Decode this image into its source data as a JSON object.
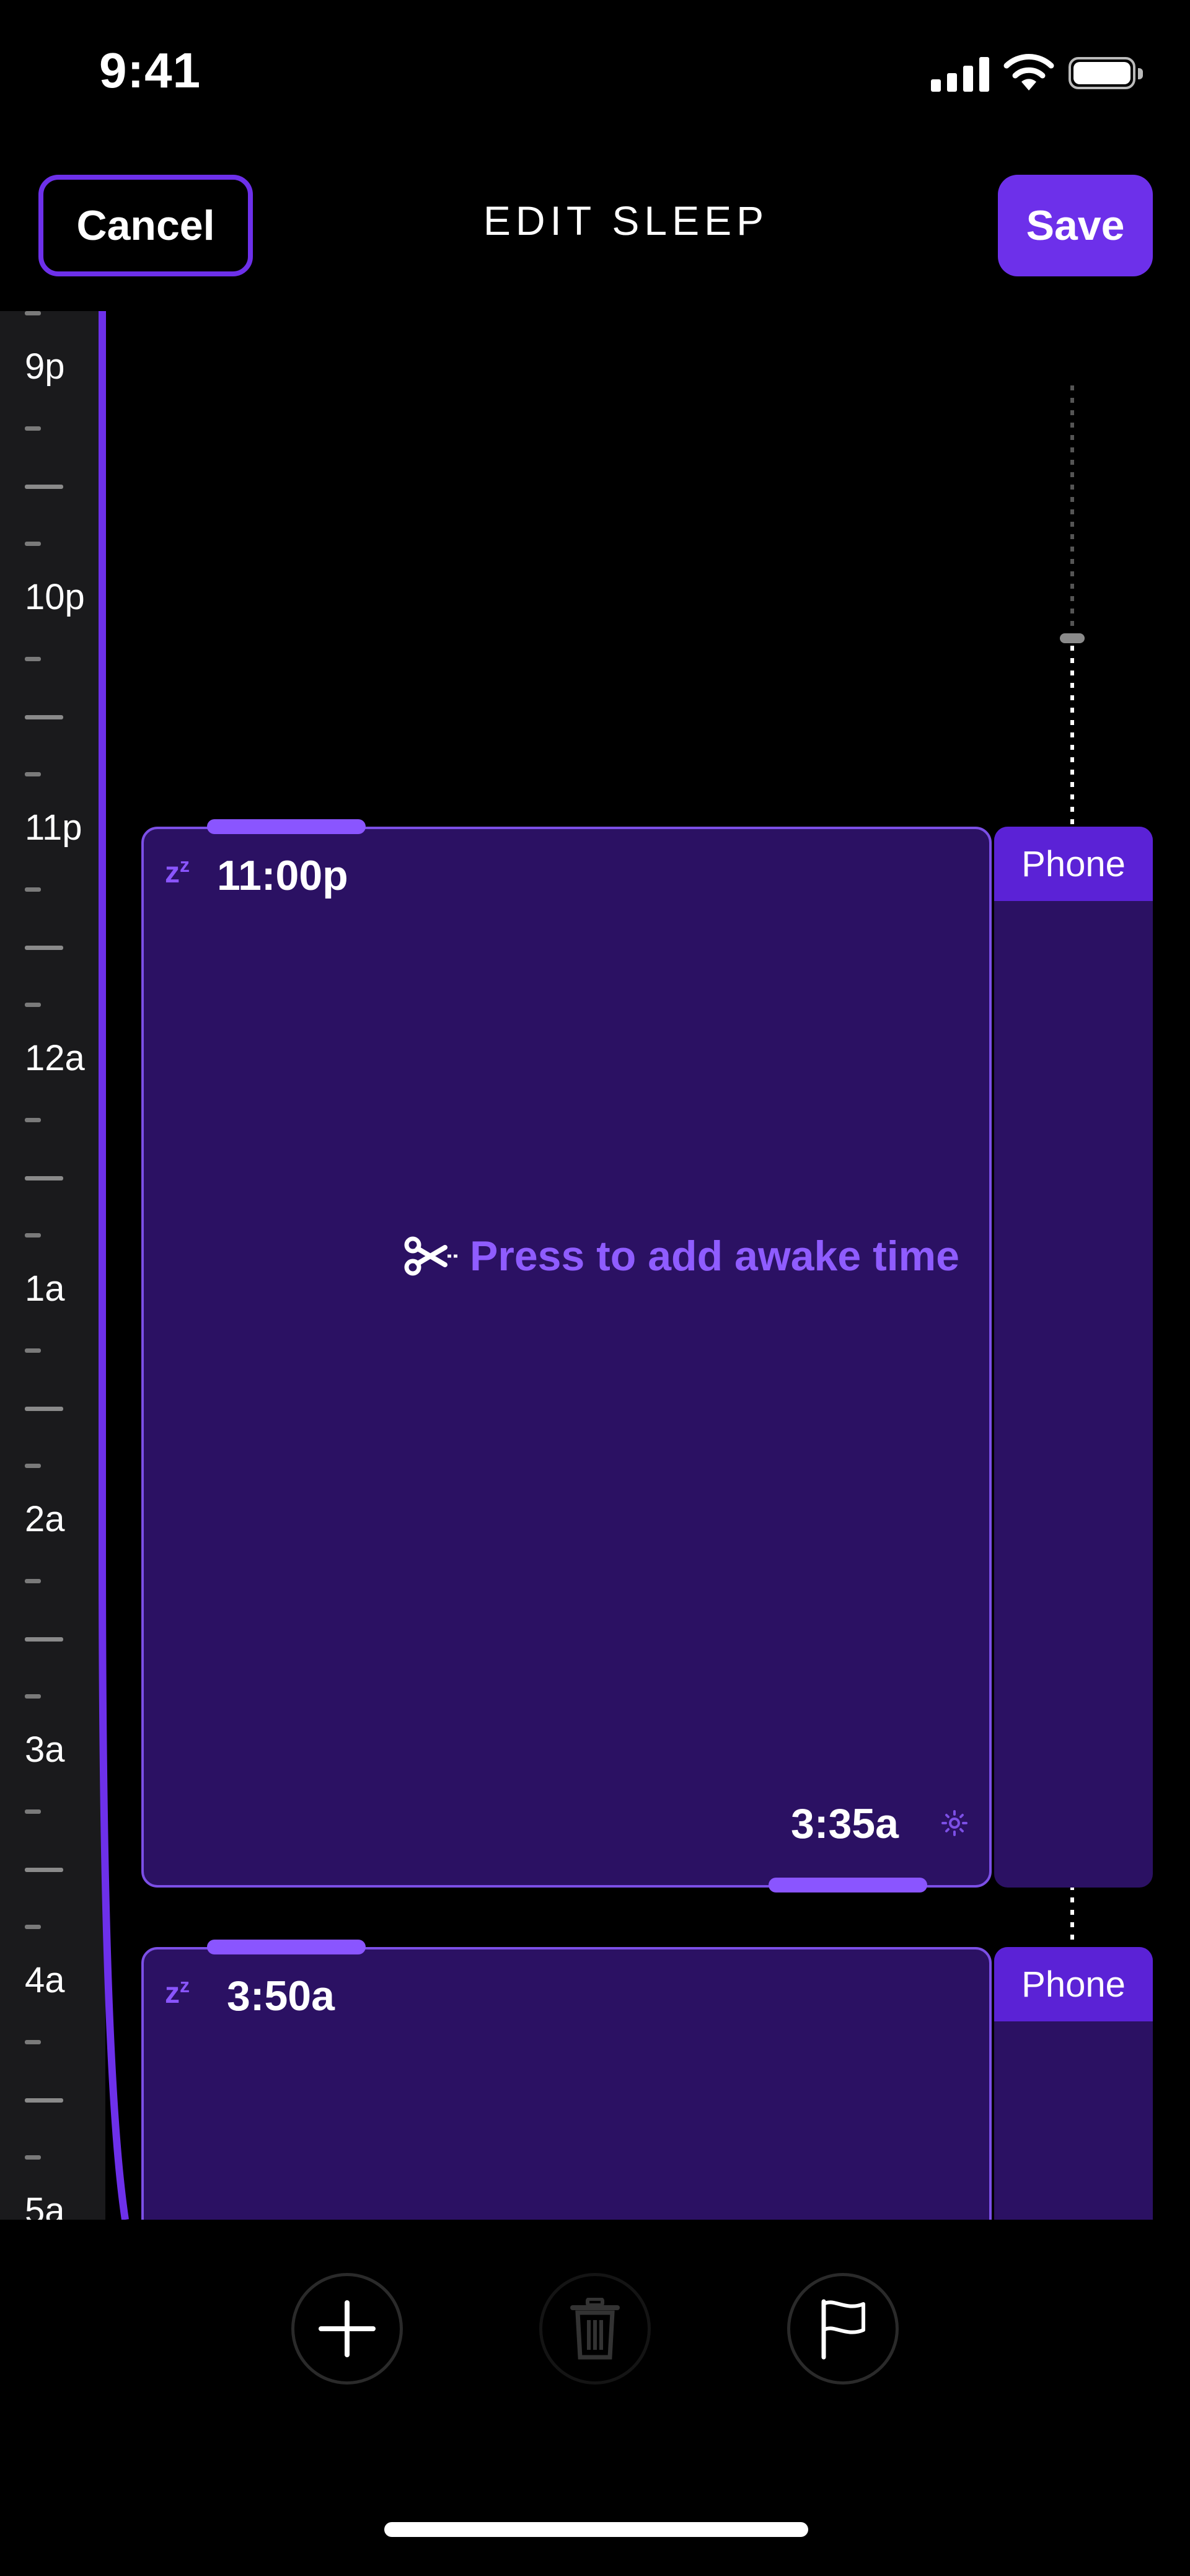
{
  "status_bar": {
    "time": "9:41"
  },
  "header": {
    "cancel_label": "Cancel",
    "title": "EDIT SLEEP",
    "save_label": "Save"
  },
  "ruler": {
    "hours": [
      "9p",
      "10p",
      "11p",
      "12a",
      "1a",
      "2a",
      "3a",
      "4a",
      "5a"
    ]
  },
  "sleep_blocks": [
    {
      "zz": "z",
      "start": "11:00p",
      "prompt": "Press to add awake time",
      "end": "3:35a",
      "source": "Phone"
    },
    {
      "zz": "z",
      "start": "3:50a",
      "source": "Phone"
    }
  ],
  "toolbar": {
    "icons": [
      "plus-icon",
      "trash-icon",
      "flag-icon"
    ]
  },
  "colors": {
    "accent": "#6d30ea",
    "block": "#2b1163",
    "prompt": "#8f5cff"
  }
}
